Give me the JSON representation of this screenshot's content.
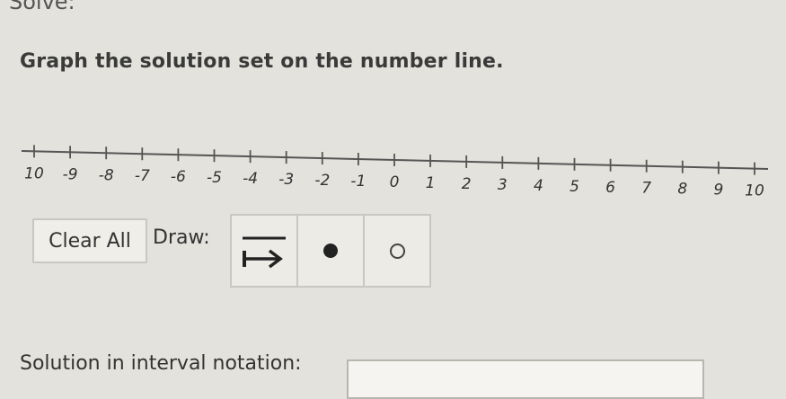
{
  "top_cut_text": "Solve: ",
  "prompt": "Graph the solution set on the number line.",
  "number_line": {
    "min": -10,
    "max": 10,
    "step": 1,
    "labels": [
      "10",
      "-9",
      "-8",
      "-7",
      "-6",
      "-5",
      "-4",
      "-3",
      "-2",
      "-1",
      "0",
      "1",
      "2",
      "3",
      "4",
      "5",
      "6",
      "7",
      "8",
      "9",
      "10"
    ]
  },
  "toolbar": {
    "clear_label": "Clear All",
    "draw_label": "Draw:",
    "tools": [
      "ray-tool-icon",
      "closed-dot-icon",
      "open-dot-icon"
    ]
  },
  "solution": {
    "label": "Solution in interval notation:",
    "value": ""
  }
}
